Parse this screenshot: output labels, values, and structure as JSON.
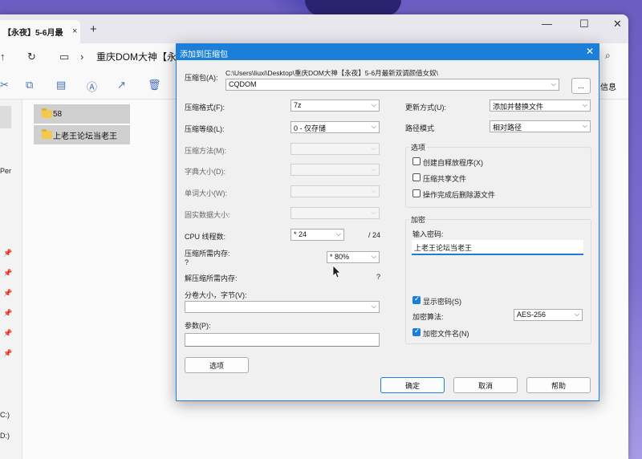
{
  "explorer": {
    "tab_title": "【永夜】5-6月最",
    "tab_close": "×",
    "tab_add": "+",
    "window_controls": [
      "—",
      "☐",
      "✕"
    ],
    "breadcrumb": "重庆DOM大神【永夜",
    "toolbar_info": "信息",
    "nav_items": [
      "Per",
      "C:)",
      "D:)"
    ],
    "files": [
      "58",
      "上老王论坛当老王"
    ]
  },
  "dialog": {
    "title": "添加到压缩包",
    "archive_label": "压缩包(A):",
    "archive_path": "C:\\Users\\liuxi\\Desktop\\重庆DOM大神【永夜】5-6月最新双调颜值女奴\\",
    "archive_name": "CQDOM",
    "browse_label": "...",
    "format_label": "压缩格式(F):",
    "format_value": "7z",
    "level_label": "压缩等级(L):",
    "level_value": "0 - 仅存储",
    "method_label": "压缩方法(M):",
    "dict_label": "字典大小(D):",
    "word_label": "单词大小(W):",
    "solid_label": "固实数据大小:",
    "cpu_label": "CPU 线程数:",
    "cpu_value": "* 24",
    "cpu_total": "/ 24",
    "mem_comp_label": "压缩所需内存:",
    "mem_comp_q": "?",
    "mem_value": "* 80%",
    "mem_decomp_label": "解压缩所需内存:",
    "mem_decomp_q": "?",
    "split_label": "分卷大小，字节(V):",
    "params_label": "参数(P):",
    "options_button": "选项",
    "update_label": "更新方式(U):",
    "update_value": "添加并替换文件",
    "path_label": "路径模式",
    "path_value": "相对路径",
    "options_group": "选项",
    "opt_sfx": "创建自释放程序(X)",
    "opt_shared": "压缩共享文件",
    "opt_delete": "操作完成后删除源文件",
    "encrypt_group": "加密",
    "pwd_label": "输入密码:",
    "pwd_value": "上老王论坛当老王",
    "show_pwd": "显示密码(S)",
    "enc_method_label": "加密算法:",
    "enc_method_value": "AES-256",
    "enc_names": "加密文件名(N)",
    "ok_button": "确定",
    "cancel_button": "取消",
    "help_button": "帮助"
  }
}
